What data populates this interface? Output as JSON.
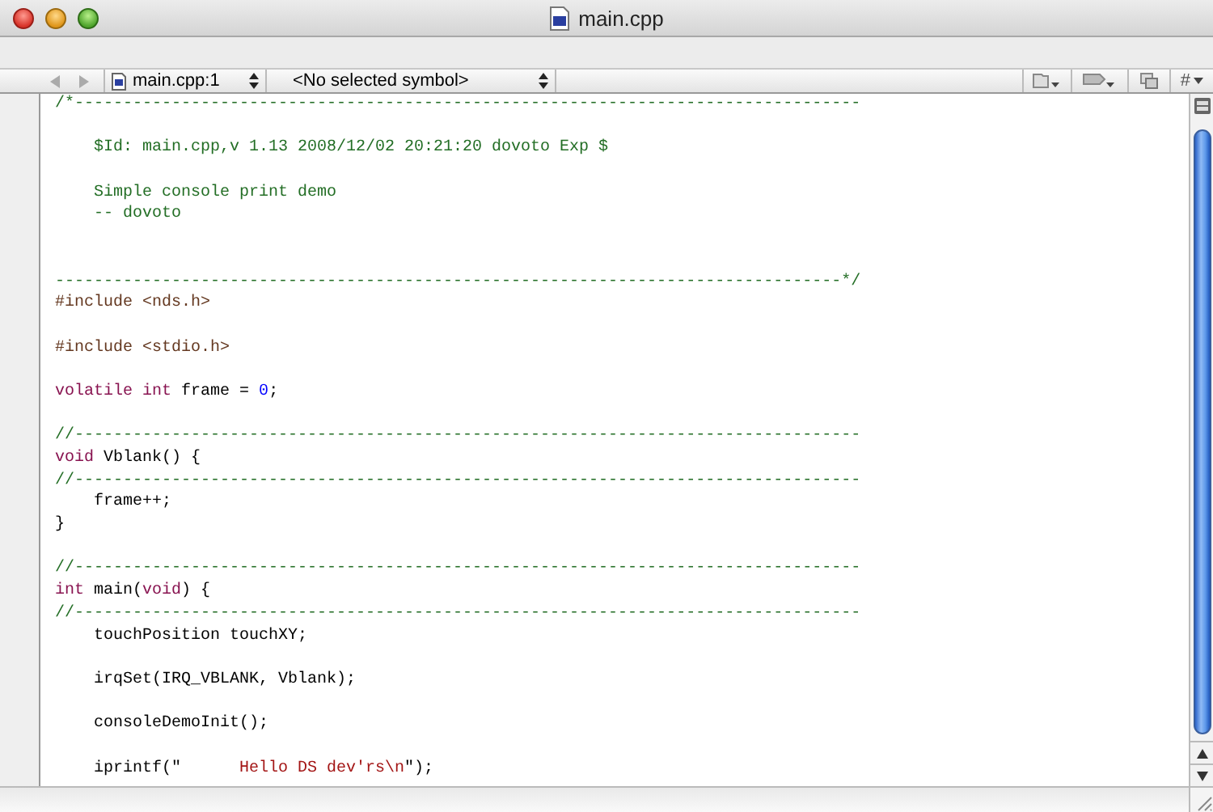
{
  "window": {
    "title": "main.cpp"
  },
  "nav_bar": {
    "file_popup": "main.cpp:1",
    "symbol_popup": "<No selected symbol>",
    "menu_button": "#"
  },
  "editor": {
    "lines": [
      {
        "kind": "code",
        "tokens": [
          {
            "kind": "comment",
            "text": "/*---------------------------------------------------------------------------------"
          }
        ]
      },
      {
        "kind": "blank"
      },
      {
        "kind": "code",
        "tokens": [
          {
            "kind": "comment",
            "text": "    $Id: main.cpp,v 1.13 2008/12/02 20:21:20 dovoto Exp $"
          }
        ]
      },
      {
        "kind": "blank"
      },
      {
        "kind": "code",
        "tokens": [
          {
            "kind": "comment",
            "text": "    Simple console print demo"
          }
        ]
      },
      {
        "kind": "code",
        "tokens": [
          {
            "kind": "comment",
            "text": "    -- dovoto"
          }
        ]
      },
      {
        "kind": "blank"
      },
      {
        "kind": "blank"
      },
      {
        "kind": "code",
        "tokens": [
          {
            "kind": "comment",
            "text": "---------------------------------------------------------------------------------*/"
          }
        ]
      },
      {
        "kind": "code",
        "tokens": [
          {
            "kind": "preprocessor",
            "text": "#include <nds.h>"
          }
        ]
      },
      {
        "kind": "blank"
      },
      {
        "kind": "code",
        "tokens": [
          {
            "kind": "preprocessor",
            "text": "#include <stdio.h>"
          }
        ]
      },
      {
        "kind": "blank"
      },
      {
        "kind": "code",
        "tokens": [
          {
            "kind": "keyword",
            "text": "volatile "
          },
          {
            "kind": "keyword",
            "text": "int"
          },
          {
            "kind": "plain",
            "text": " frame = "
          },
          {
            "kind": "number",
            "text": "0"
          },
          {
            "kind": "plain",
            "text": ";"
          }
        ]
      },
      {
        "kind": "blank"
      },
      {
        "kind": "code",
        "tokens": [
          {
            "kind": "comment",
            "text": "//---------------------------------------------------------------------------------"
          }
        ]
      },
      {
        "kind": "code",
        "tokens": [
          {
            "kind": "keyword",
            "text": "void"
          },
          {
            "kind": "plain",
            "text": " Vblank() {"
          }
        ]
      },
      {
        "kind": "code",
        "tokens": [
          {
            "kind": "comment",
            "text": "//---------------------------------------------------------------------------------"
          }
        ]
      },
      {
        "kind": "code",
        "tokens": [
          {
            "kind": "plain",
            "text": "    frame++;"
          }
        ]
      },
      {
        "kind": "code",
        "tokens": [
          {
            "kind": "plain",
            "text": "}"
          }
        ]
      },
      {
        "kind": "blank"
      },
      {
        "kind": "code",
        "tokens": [
          {
            "kind": "comment",
            "text": "//---------------------------------------------------------------------------------"
          }
        ]
      },
      {
        "kind": "code",
        "tokens": [
          {
            "kind": "keyword",
            "text": "int"
          },
          {
            "kind": "plain",
            "text": " main("
          },
          {
            "kind": "keyword",
            "text": "void"
          },
          {
            "kind": "plain",
            "text": ") {"
          }
        ]
      },
      {
        "kind": "code",
        "tokens": [
          {
            "kind": "comment",
            "text": "//---------------------------------------------------------------------------------"
          }
        ]
      },
      {
        "kind": "code",
        "tokens": [
          {
            "kind": "plain",
            "text": "    touchPosition touchXY;"
          }
        ]
      },
      {
        "kind": "blank"
      },
      {
        "kind": "code",
        "tokens": [
          {
            "kind": "plain",
            "text": "    irqSet(IRQ_VBLANK, Vblank);"
          }
        ]
      },
      {
        "kind": "blank"
      },
      {
        "kind": "code",
        "tokens": [
          {
            "kind": "plain",
            "text": "    consoleDemoInit();"
          }
        ]
      },
      {
        "kind": "blank"
      },
      {
        "kind": "code",
        "tokens": [
          {
            "kind": "plain",
            "text": "    iprintf(\""
          },
          {
            "kind": "string",
            "text": "      Hello DS dev'rs\\n"
          },
          {
            "kind": "plain",
            "text": "\");"
          }
        ]
      }
    ]
  }
}
